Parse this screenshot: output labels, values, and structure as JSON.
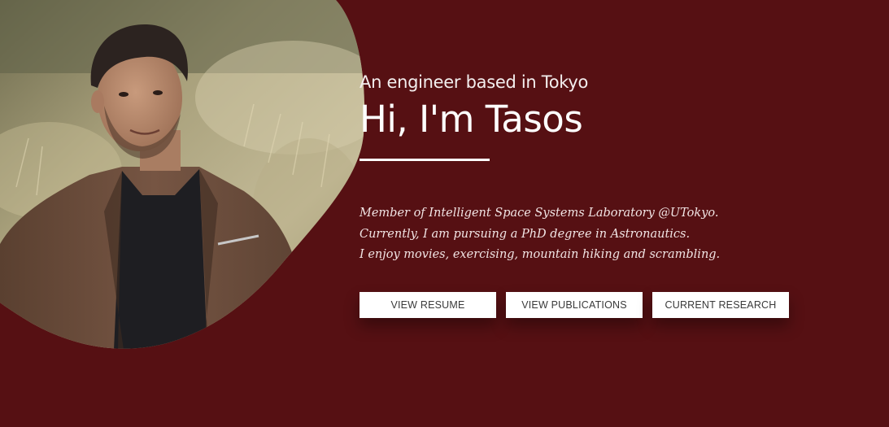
{
  "colors": {
    "background": "#561013",
    "text": "#ffffff",
    "button_background": "#ffffff",
    "button_text": "#3a3a3a"
  },
  "photo": {
    "icon": "portrait-photo"
  },
  "hero": {
    "tagline": "An engineer based in Tokyo",
    "headline": "Hi, I'm Tasos",
    "bio": [
      "Member of Intelligent Space Systems Laboratory @UTokyo.",
      "Currently, I am pursuing a PhD degree in Astronautics.",
      "I enjoy movies, exercising, mountain hiking and scrambling."
    ]
  },
  "buttons": {
    "resume": "VIEW RESUME",
    "publications": "VIEW PUBLICATIONS",
    "research": "CURRENT RESEARCH"
  }
}
